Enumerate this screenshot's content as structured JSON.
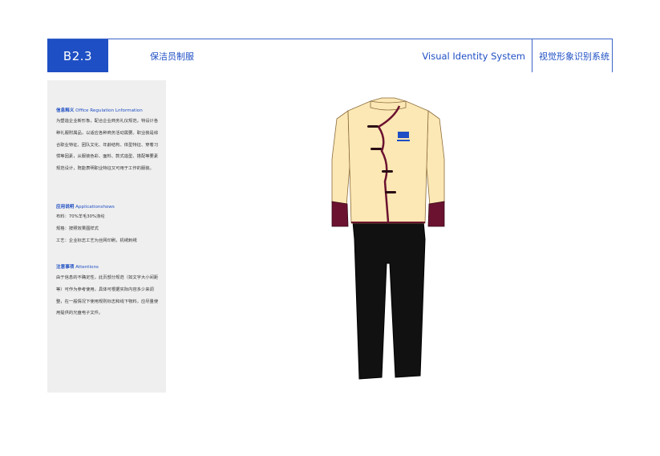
{
  "header": {
    "code": "B2.3",
    "title": "保洁员制服",
    "vis_en": "Visual Identity System",
    "vis_cn": "视觉形象识别系统"
  },
  "sidebar": {
    "design_intent": {
      "title_cn": "信息释义",
      "title_en": "Office Regulation Lnformation",
      "text": "为塑造企业新形象，配合企业商务礼仪规范，特设计各种礼服附属品，以适应各种商务活动需要。职业装是综合职业特征、团队文化、年龄结构、体型特征、穿着习惯等因素，从服装色彩、面料、款式造型、搭配等要素规范设计，既能表明职业特征又可用于工作的服装。"
    },
    "application": {
      "title_cn": "应用说明",
      "title_en": "Applicationshows",
      "lines": [
        "布料：70%羊毛30%涤纶",
        "规格：按照效果图样式",
        "工艺：企业标志工艺为丝网印刷，机绣刺绣"
      ]
    },
    "attention": {
      "title_cn": "注意事项",
      "title_en": "Attentions",
      "text": "由于信息的不确定性，此页部分规范（如文字大小间距等）可作为参考使用，具体可根据实际内容多少来调整，在一般情况下使用规则标志和线下物料，应尽量使用提供的光盘电子文件。"
    }
  },
  "colors": {
    "brand_blue": "#1f4fc4",
    "jacket": "#fce8b4",
    "trim": "#6b1230",
    "pants": "#111111",
    "sidebar_bg": "#efefef"
  }
}
